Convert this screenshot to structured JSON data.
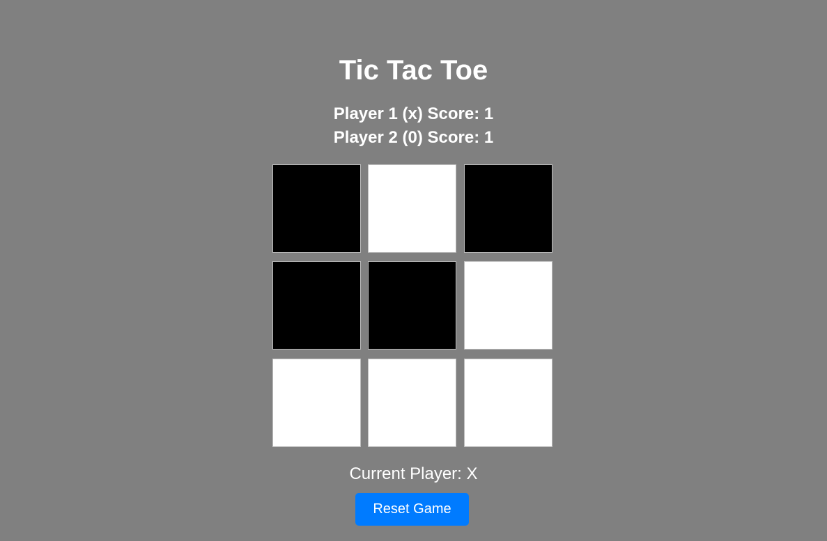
{
  "game": {
    "title": "Tic Tac Toe",
    "player1_score": "Player 1 (x) Score: 1",
    "player2_score": "Player 2 (0) Score: 1",
    "current_player": "Current Player: X",
    "reset_label": "Reset Game"
  },
  "board": {
    "cells": [
      "filled",
      "empty",
      "filled",
      "filled",
      "filled",
      "empty",
      "empty",
      "empty",
      "empty"
    ]
  },
  "colors": {
    "background": "#808080",
    "filled_cell": "#000000",
    "empty_cell": "#ffffff",
    "button": "#007bff",
    "text": "#ffffff"
  }
}
